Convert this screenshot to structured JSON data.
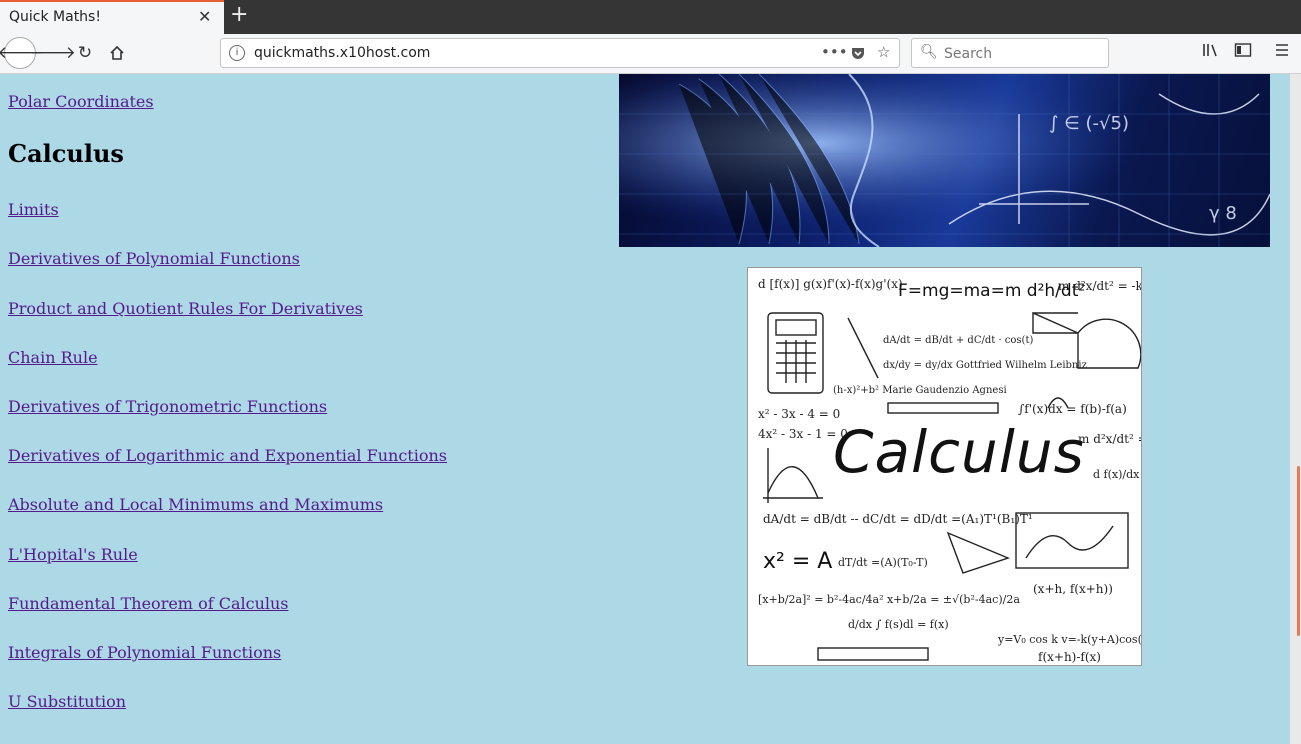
{
  "browser": {
    "tab_title": "Quick Maths!",
    "tab_close": "✕",
    "new_tab": "+",
    "url": "quickmaths.x10host.com",
    "search_placeholder": "Search",
    "accent": "#e76134"
  },
  "page": {
    "background": "#add8e6",
    "link_color": "#551a8b",
    "top_link": "Polar Coordinates",
    "section_heading": "Calculus",
    "links": [
      "Limits",
      "Derivatives of Polynomial Functions",
      "Product and Quotient Rules For Derivatives",
      "Chain Rule",
      "Derivatives of Trigonometric Functions",
      "Derivatives of Logarithmic and Exponential Functions",
      "Absolute and Local Minimums and Maximums",
      "L'Hopital's Rule",
      "Fundamental Theorem of Calculus",
      "Integrals of Polynomial Functions",
      "U Substitution"
    ],
    "calc_image_word": "Calculus"
  }
}
